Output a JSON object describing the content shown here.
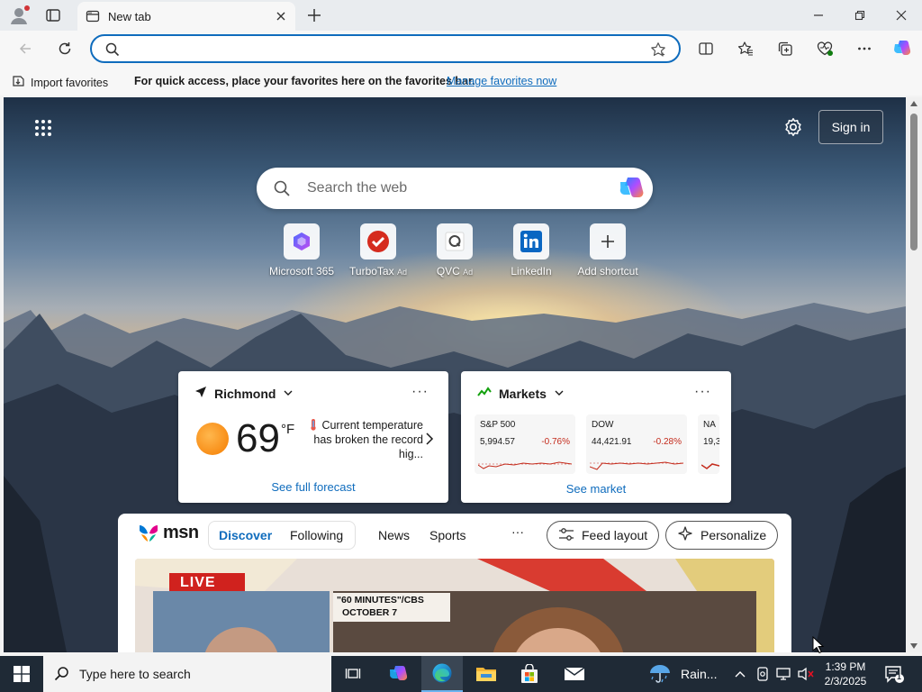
{
  "browser": {
    "tab_title": "New tab",
    "address_value": "",
    "favorites_bar": {
      "import_label": "Import favorites",
      "hint": "For quick access, place your favorites here on the favorites bar.",
      "manage_link": "Manage favorites now"
    }
  },
  "newtab": {
    "sign_in_label": "Sign in",
    "search_placeholder": "Search the web",
    "shortcuts": [
      {
        "label": "Microsoft 365",
        "ad": ""
      },
      {
        "label": "TurboTax",
        "ad": "Ad"
      },
      {
        "label": "QVC",
        "ad": "Ad"
      },
      {
        "label": "LinkedIn",
        "ad": ""
      },
      {
        "label": "Add shortcut",
        "ad": ""
      }
    ],
    "weather": {
      "location": "Richmond",
      "temperature": "69",
      "unit": "°F",
      "alert": "Current temperature has broken the record hig...",
      "forecast_link": "See full forecast"
    },
    "markets": {
      "title": "Markets",
      "tickers": [
        {
          "name": "S&P 500",
          "value": "5,994.57",
          "change": "-0.76%"
        },
        {
          "name": "DOW",
          "value": "44,421.91",
          "change": "-0.28%"
        },
        {
          "name": "NA",
          "value": "19,3",
          "change": ""
        }
      ],
      "see_market_link": "See market"
    },
    "feed": {
      "brand": "msn",
      "tabs": [
        "Discover",
        "Following"
      ],
      "active_tab": "Discover",
      "nav": [
        "News",
        "Sports"
      ],
      "more": "···",
      "feed_layout_label": "Feed layout",
      "personalize_label": "Personalize",
      "hero_badge": "LIVE",
      "hero_caption_line1": "\"60 MINUTES\"/CBS",
      "hero_caption_line2": "OCTOBER 7"
    }
  },
  "taskbar": {
    "search_placeholder": "Type here to search",
    "weather_label": "Rain...",
    "time": "1:39 PM",
    "date": "2/3/2025",
    "notification_count": "1"
  },
  "colors": {
    "accent": "#0f6cbd",
    "negative": "#c42b1c",
    "taskbar": "#1f2a36"
  }
}
